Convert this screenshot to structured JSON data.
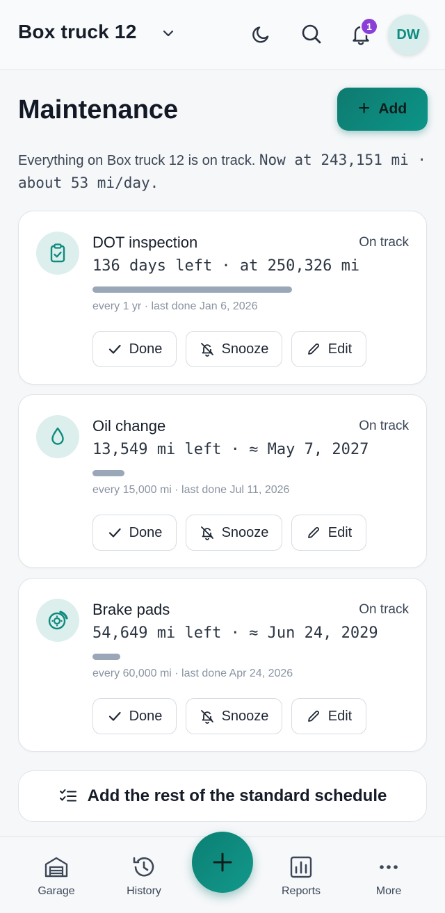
{
  "header": {
    "vehicle_title": "Box truck 12",
    "notification_count": "1",
    "avatar_initials": "DW"
  },
  "page": {
    "title": "Maintenance",
    "add_label": "Add",
    "summary_prefix": "Everything on Box truck 12 is on track.",
    "summary_mileage": "Now at 243,151 mi · about 53 mi/day."
  },
  "items": [
    {
      "title": "DOT inspection",
      "status": "On track",
      "remaining": "136 days left · at 250,326 mi",
      "progress_fraction": 1.0,
      "meta": "every 1 yr · last done Jan 6, 2026",
      "icon": "clipboard-check-icon",
      "done_label": "Done",
      "snooze_label": "Snooze",
      "edit_label": "Edit"
    },
    {
      "title": "Oil change",
      "status": "On track",
      "remaining": "13,549 mi left · ≈ May 7, 2027",
      "progress_fraction": 0.16,
      "meta": "every 15,000 mi · last done Jul 11, 2026",
      "icon": "droplet-icon",
      "done_label": "Done",
      "snooze_label": "Snooze",
      "edit_label": "Edit"
    },
    {
      "title": "Brake pads",
      "status": "On track",
      "remaining": "54,649 mi left · ≈ Jun 24, 2029",
      "progress_fraction": 0.14,
      "meta": "every 60,000 mi · last done Apr 24, 2026",
      "icon": "brake-disc-icon",
      "done_label": "Done",
      "snooze_label": "Snooze",
      "edit_label": "Edit"
    }
  ],
  "schedule_button_label": "Add the rest of the standard schedule",
  "nav": {
    "garage": "Garage",
    "history": "History",
    "reports": "Reports",
    "more": "More"
  },
  "colors": {
    "accent": "#0f8a7e",
    "badge": "#8b3fd9",
    "progress": "#9aa7b8"
  }
}
